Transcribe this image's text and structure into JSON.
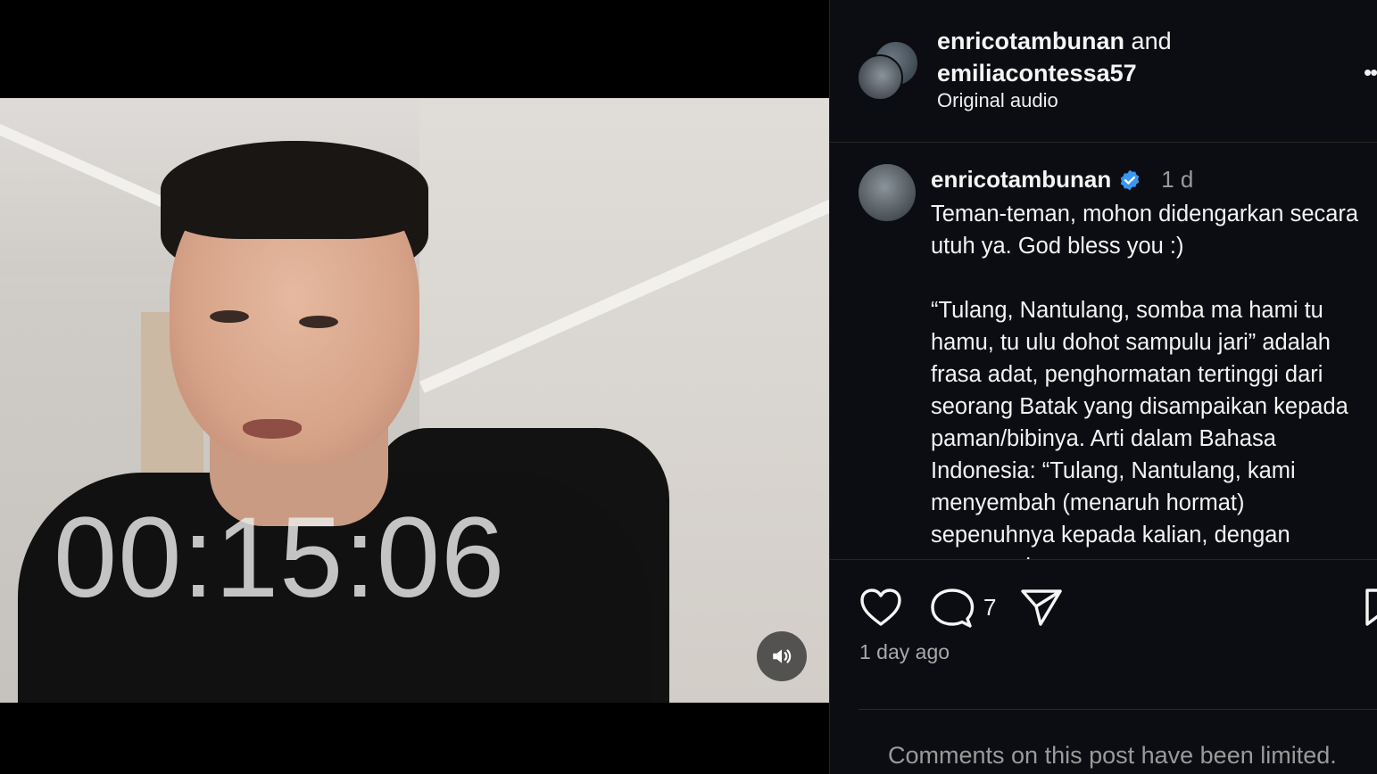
{
  "video": {
    "timer": "00:15:06",
    "mute_icon": "speaker-icon"
  },
  "header": {
    "user1": "enricotambunan",
    "conjunction": "and",
    "user2": "emiliacontessa57",
    "audio": "Original audio",
    "more_icon": "ellipsis-icon"
  },
  "caption": {
    "username": "enricotambunan",
    "verified_icon": "verified-badge-icon",
    "time": "1 d",
    "text": "Teman-teman, mohon didengarkan secara utuh ya. God bless you :)\n\n“Tulang, Nantulang, somba ma hami tu hamu, tu ulu dohot sampulu jari” adalah frasa adat, penghormatan tertinggi dari seorang Batak yang disampaikan kepada paman/bibinya. Arti dalam Bahasa Indonesia: “Tulang, Nantulang, kami menyembah (menaruh hormat) sepenuhnya kepada kalian, dengan mengangkat"
  },
  "actions": {
    "comment_count": "7",
    "posted_ago": "1 day ago"
  },
  "footer": {
    "comments_limited": "Comments on this post have been limited."
  },
  "colors": {
    "panel_bg": "#0b0d12",
    "verified_blue": "#3897f0",
    "muted_text": "#a8a8a8"
  }
}
